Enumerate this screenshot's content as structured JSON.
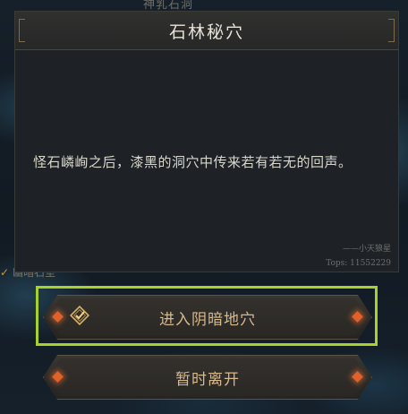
{
  "map": {
    "top_label": "神乳石洞",
    "left_label": "幽暗石室"
  },
  "dialog": {
    "title": "石林秘穴",
    "story_text": "怪石嶙峋之后，漆黑的洞穴中传来若有若无的回声。",
    "author": "——小天狼星",
    "author_id": "Tops: 11552229"
  },
  "actions": {
    "enter_label": "进入阴暗地穴",
    "leave_label": "暂时离开"
  },
  "colors": {
    "highlight": "#a6d22b",
    "button_text": "#d7b98a",
    "ornament": "#e0612a"
  },
  "icons": {
    "enter": "quest-check-icon"
  }
}
